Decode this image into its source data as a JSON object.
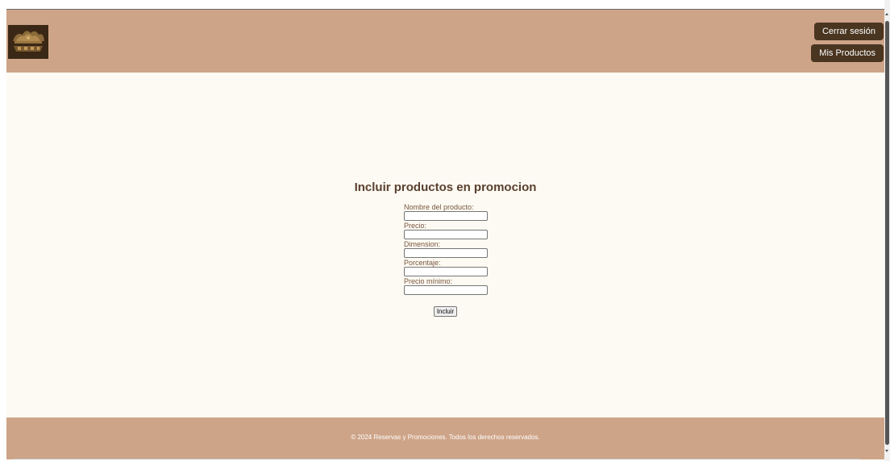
{
  "header": {
    "logo_icon": "decorative-crest-logo",
    "logout_label": "Cerrar sesión",
    "products_label": "Mis Productos"
  },
  "form": {
    "title": "Incluir productos en promocion",
    "fields": [
      {
        "label": "Nombre del producto:",
        "value": ""
      },
      {
        "label": "Precio:",
        "value": ""
      },
      {
        "label": "Dimension:",
        "value": ""
      },
      {
        "label": "Porcentaje:",
        "value": ""
      },
      {
        "label": "Precio mínimo:",
        "value": ""
      }
    ],
    "submit_label": "Incluir"
  },
  "footer": {
    "text": "© 2024 Reservas y Promociones. Todos los derechos reservados."
  },
  "colors": {
    "header_bg": "#cea488",
    "page_bg": "#fcfaf2",
    "button_bg": "#4a3520",
    "title_color": "#5a3f2e"
  }
}
